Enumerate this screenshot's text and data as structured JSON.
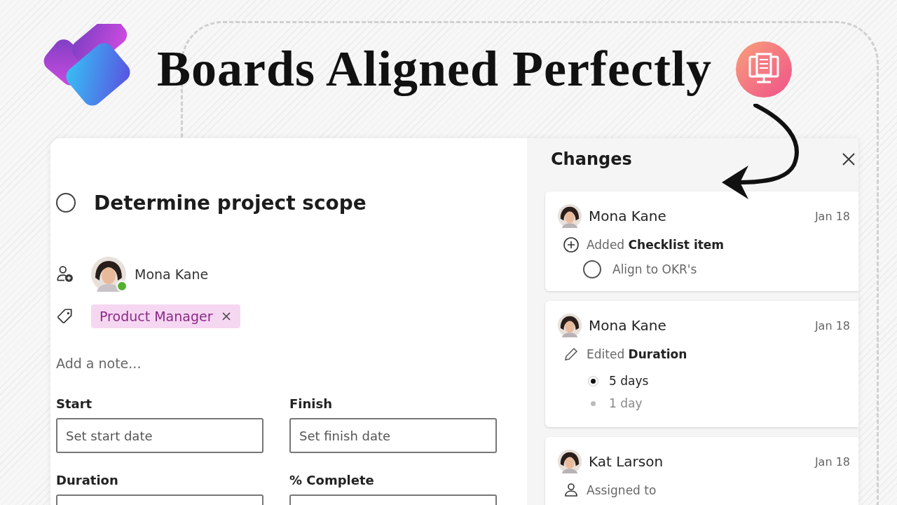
{
  "header": {
    "title": "Boards Aligned Perfectly"
  },
  "task": {
    "title": "Determine project scope",
    "completed": false,
    "assignee": {
      "name": "Mona Kane",
      "online": true
    },
    "labels": [
      {
        "text": "Product Manager"
      }
    ],
    "note_placeholder": "Add a note...",
    "fields": [
      {
        "label": "Start",
        "placeholder": "Set start date"
      },
      {
        "label": "Finish",
        "placeholder": "Set finish date"
      },
      {
        "label": "Duration"
      },
      {
        "label": "% Complete"
      }
    ]
  },
  "changes": {
    "title": "Changes",
    "entries": [
      {
        "kind": "added",
        "author": "Mona Kane",
        "date": "Jan 18",
        "action": "Added **Checklist item**",
        "item": {
          "text": "Align to OKR's",
          "checked": false
        }
      },
      {
        "kind": "edited",
        "author": "Mona Kane",
        "date": "Jan 18",
        "action": "Edited **Duration**",
        "values": [
          {
            "text": "5 days",
            "selected": true
          },
          {
            "text": "1 day",
            "selected": false
          }
        ]
      },
      {
        "kind": "assigned",
        "author": "Kat Larson",
        "date": "Jan 18",
        "action": "Assigned to"
      }
    ]
  }
}
